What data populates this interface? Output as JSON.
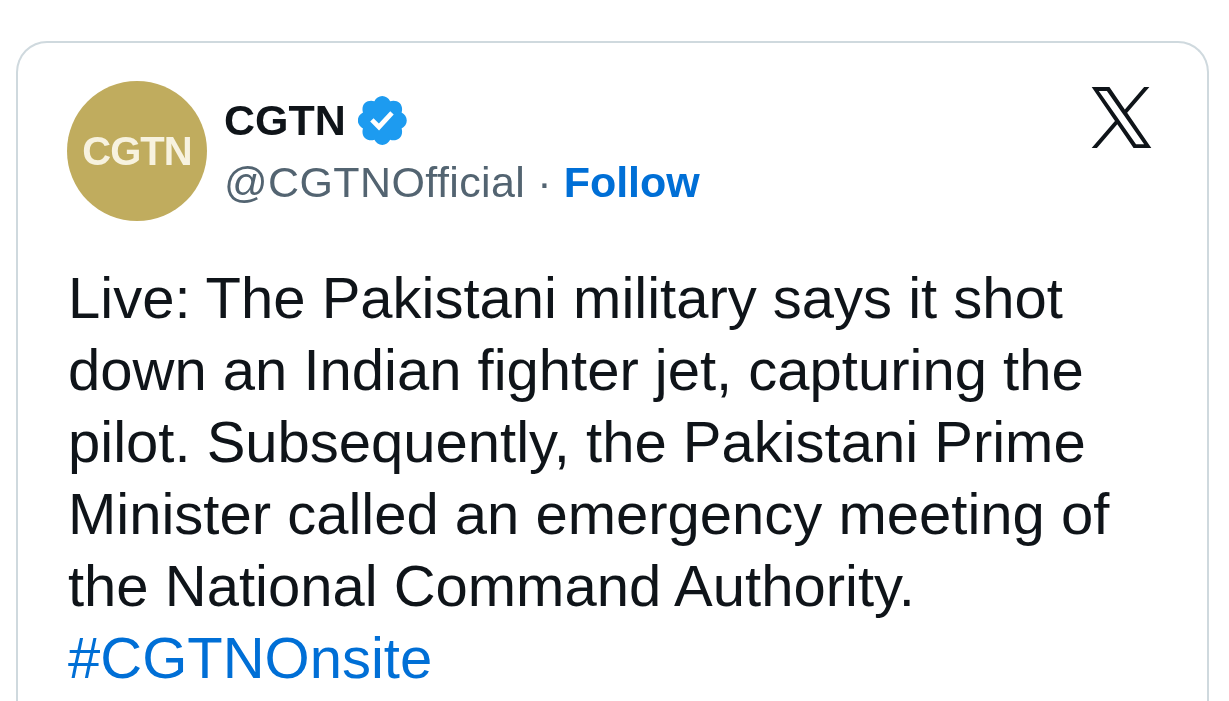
{
  "tweet": {
    "author": {
      "avatar_text": "CGTN",
      "name": "CGTN",
      "verified": true,
      "handle": "@CGTNOfficial",
      "separator": "·",
      "follow_label": "Follow"
    },
    "text": "Live: The Pakistani military says it shot down an Indian fighter jet, capturing the pilot. Subsequently, the Pakistani Prime Minister called an emergency meeting of the National Command Authority.",
    "hashtag": "#CGTNOnsite"
  }
}
